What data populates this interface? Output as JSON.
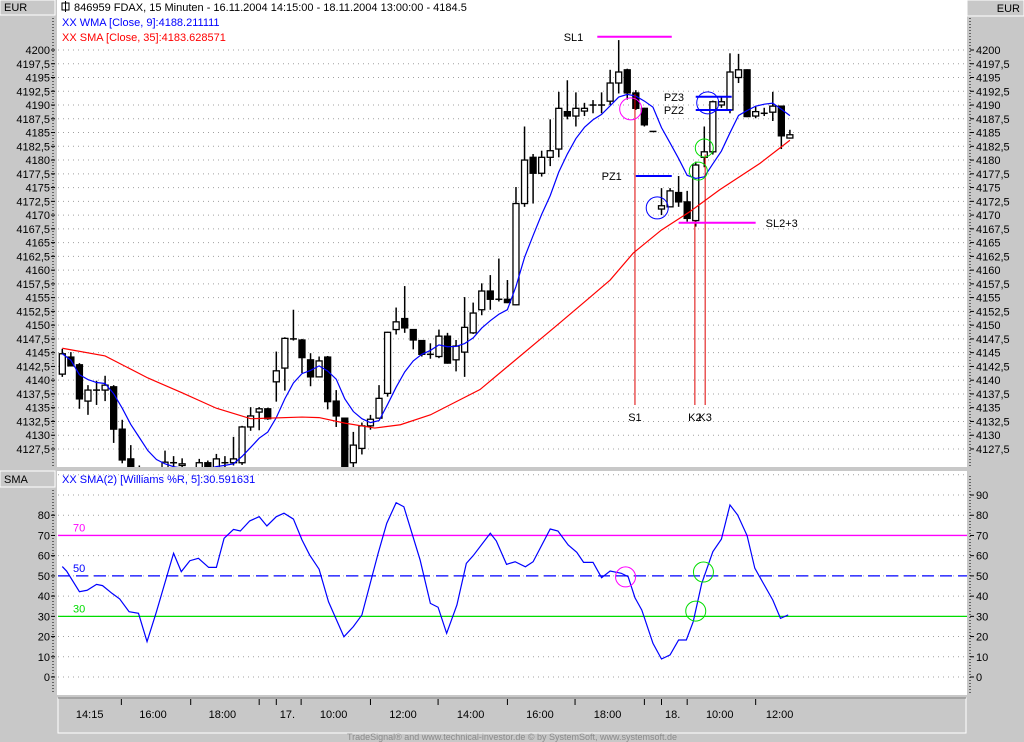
{
  "header": {
    "left_unit": "EUR",
    "right_unit": "EUR",
    "title": "846959  FDAX, 15 Minuten - 16.11.2004 14:15:00 - 18.11.2004 13:00:00 - 4184.5",
    "legend_wma": "XX WMA [Close, 9]:4188.211111",
    "legend_sma": "XX SMA [Close, 35]:4183.628571",
    "indicator_unit": "SMA",
    "legend_indicator": "XX SMA(2) [Williams %R, 5]:30.591631"
  },
  "footer": "TradeSignal® and www.technical-investor.de © by SystemSoft, www.systemsoft.de",
  "colors": {
    "wma": "#0000ff",
    "sma": "#ff0000",
    "level70": "#ff00ff",
    "level50": "#0000ff",
    "level30": "#00e000",
    "annot_magenta": "#ff00ff",
    "annot_blue": "#0000ff",
    "annot_green": "#00dd00",
    "vline": "#dd0000"
  },
  "chart_data": [
    {
      "type": "candlestick",
      "title": "846959 FDAX, 15 Minuten",
      "ylim": [
        4127.5,
        4200
      ],
      "price_ticks": [
        "4200",
        "4197,5",
        "4195",
        "4192,5",
        "4190",
        "4187,5",
        "4185",
        "4182,5",
        "4180",
        "4177,5",
        "4175",
        "4172,5",
        "4170",
        "4167,5",
        "4165",
        "4162,5",
        "4160",
        "4157,5",
        "4155",
        "4152,5",
        "4150",
        "4147,5",
        "4145",
        "4142,5",
        "4140",
        "4137,5",
        "4135",
        "4132,5",
        "4130",
        "4127,5"
      ],
      "price_tick_values": [
        4200,
        4197.5,
        4195,
        4192.5,
        4190,
        4187.5,
        4185,
        4182.5,
        4180,
        4177.5,
        4175,
        4172.5,
        4170,
        4167.5,
        4165,
        4162.5,
        4160,
        4157.5,
        4155,
        4152.5,
        4150,
        4147.5,
        4145,
        4142.5,
        4140,
        4137.5,
        4135,
        4132.5,
        4130,
        4127.5
      ],
      "ohlc_columns": [
        "open",
        "high",
        "low",
        "close"
      ],
      "ohlc": [
        [
          4141.1,
          4145.7,
          4140.6,
          4144.8
        ],
        [
          4144.2,
          4145.1,
          4142.6,
          4142.6
        ],
        [
          4142.8,
          4143.1,
          4134.8,
          4136.6
        ],
        [
          4136.2,
          4139.1,
          4133.7,
          4138.2
        ],
        [
          4138.2,
          4139.9,
          4135.5,
          4138.2
        ],
        [
          4138.2,
          4140.8,
          4136.2,
          4139.1
        ],
        [
          4138.8,
          4139.1,
          4128.6,
          4131.1
        ],
        [
          4131.1,
          4132.8,
          4124.9,
          4125.5
        ],
        [
          4125.7,
          4128.2,
          4120,
          4122
        ],
        [
          4123,
          4124.5,
          4121,
          4123.5
        ],
        [
          4122.5,
          4123.5,
          4120,
          4121
        ],
        [
          4121,
          4123,
          4119.5,
          4122.5
        ],
        [
          4124,
          4127.2,
          4122,
          4125.1
        ],
        [
          4125,
          4126.2,
          4123,
          4125
        ],
        [
          4124.5,
          4125.8,
          4123,
          4124.8
        ],
        [
          4122,
          4123.5,
          4121,
          4123
        ],
        [
          4123,
          4125.7,
          4122,
          4125
        ],
        [
          4125,
          4125.4,
          4122,
          4123
        ],
        [
          4123,
          4126.6,
          4122,
          4125.7
        ],
        [
          4125,
          4126.2,
          4124,
          4125
        ],
        [
          4125,
          4129.7,
          4124.5,
          4125.7
        ],
        [
          4125,
          4131.7,
          4124.6,
          4131.5
        ],
        [
          4131.5,
          4135.1,
          4130.8,
          4133.5
        ],
        [
          4134.2,
          4135.1,
          4130.9,
          4134.8
        ],
        [
          4134.8,
          4135,
          4132.8,
          4133
        ],
        [
          4139.7,
          4145.2,
          4136.1,
          4141.7
        ],
        [
          4142.2,
          4147.8,
          4138.1,
          4147.6
        ],
        [
          4147.5,
          4152.8,
          4147.2,
          4147.5
        ],
        [
          4147.3,
          4147.5,
          4141.3,
          4144.1
        ],
        [
          4143.7,
          4144.9,
          4138.9,
          4140.6
        ],
        [
          4140.6,
          4144.3,
          4140.5,
          4143.5
        ],
        [
          4144.2,
          4144.4,
          4134.7,
          4136.1
        ],
        [
          4136.2,
          4138.2,
          4131.5,
          4133.5
        ],
        [
          4133.1,
          4133.1,
          4122,
          4123
        ],
        [
          4125,
          4130.6,
          4123,
          4128.2
        ],
        [
          4127.6,
          4132.3,
          4126.5,
          4131.7
        ],
        [
          4131.7,
          4133.7,
          4131,
          4132.9
        ],
        [
          4133.1,
          4139.1,
          4133,
          4136.7
        ],
        [
          4137.6,
          4148.8,
          4137,
          4148.7
        ],
        [
          4149.2,
          4153.2,
          4148.3,
          4150.6
        ],
        [
          4151.2,
          4157.1,
          4148.6,
          4149.5
        ],
        [
          4149.2,
          4149.3,
          4145.6,
          4147.3
        ],
        [
          4147.2,
          4147.3,
          4144.3,
          4144.7
        ],
        [
          4144.7,
          4146.7,
          4143.9,
          4144.7
        ],
        [
          4144.3,
          4149.2,
          4144,
          4148
        ],
        [
          4148,
          4148.6,
          4143,
          4143.1
        ],
        [
          4143.7,
          4147.3,
          4141.6,
          4146.2
        ],
        [
          4145.1,
          4155.1,
          4140.6,
          4149.6
        ],
        [
          4148.6,
          4154.1,
          4148.4,
          4152.2
        ],
        [
          4152.8,
          4157.6,
          4151.8,
          4156.2
        ],
        [
          4156.2,
          4159.1,
          4152.8,
          4154.7
        ],
        [
          4154.7,
          4162.1,
          4154.3,
          4154.7
        ],
        [
          4154.7,
          4158.2,
          4154,
          4154.1
        ],
        [
          4153.7,
          4175.1,
          4153.6,
          4172.1
        ],
        [
          4172.1,
          4186.1,
          4171.5,
          4180
        ],
        [
          4180.5,
          4181.1,
          4172.1,
          4177.6
        ],
        [
          4177.6,
          4181.7,
          4177,
          4180.5
        ],
        [
          4180.5,
          4187.4,
          4178.9,
          4181.7
        ],
        [
          4182,
          4192.4,
          4180.5,
          4189.4
        ],
        [
          4188.8,
          4194.5,
          4187.4,
          4188
        ],
        [
          4188,
          4192.3,
          4186.1,
          4189.4
        ],
        [
          4188.9,
          4190.4,
          4188,
          4189.4
        ],
        [
          4190,
          4190.9,
          4188.5,
          4190
        ],
        [
          4190,
          4192.3,
          4188.5,
          4190
        ],
        [
          4190.7,
          4196.4,
          4190,
          4194
        ],
        [
          4194,
          4201.8,
          4192.1,
          4196
        ],
        [
          4196.4,
          4196.6,
          4191,
          4192.2
        ],
        [
          4192.2,
          4192.7,
          4189.1,
          4189.4
        ],
        [
          4189.4,
          4189.5,
          4186.1,
          4186.4
        ],
        [
          4185.2,
          4185.2,
          4185.2,
          4185.2
        ],
        [
          4171.1,
          4174.9,
          4170,
          4171.7
        ],
        [
          4171.5,
          4174.9,
          4171.5,
          4174.4
        ],
        [
          4174.1,
          4177.1,
          4171.5,
          4172.4
        ],
        [
          4172.4,
          4174.4,
          4168.8,
          4169.4
        ],
        [
          4169,
          4179.7,
          4167.9,
          4179.1
        ],
        [
          4180.5,
          4186.1,
          4178.7,
          4181.5
        ],
        [
          4181.5,
          4190.8,
          4181,
          4190.6
        ],
        [
          4190,
          4191.5,
          4189.5,
          4190.6
        ],
        [
          4189.1,
          4199.4,
          4188.5,
          4196
        ],
        [
          4195,
          4199.3,
          4194,
          4196.4
        ],
        [
          4196.4,
          4196.5,
          4187.8,
          4187.9
        ],
        [
          4188,
          4189.7,
          4187.6,
          4188.8
        ],
        [
          4188.5,
          4189.5,
          4188,
          4188.5
        ],
        [
          4188.7,
          4192.4,
          4187.1,
          4189.8
        ],
        [
          4189.8,
          4189.9,
          4182,
          4184.4
        ],
        [
          4184,
          4185.5,
          4183.9,
          4184.6
        ]
      ],
      "wma_period": 9,
      "sma_points": [
        [
          0,
          4145.8
        ],
        [
          5,
          4144.4
        ],
        [
          10,
          4140.4
        ],
        [
          14,
          4137.7
        ],
        [
          18,
          4134.9
        ],
        [
          22,
          4133.0
        ],
        [
          28,
          4133.3
        ],
        [
          30,
          4133.2
        ],
        [
          33,
          4132.2
        ],
        [
          36.5,
          4131.3
        ],
        [
          39.5,
          4131.9
        ],
        [
          43,
          4133.7
        ],
        [
          48.8,
          4138.3
        ],
        [
          57.8,
          4150
        ],
        [
          61.3,
          4154.6
        ],
        [
          64,
          4158.2
        ],
        [
          66.7,
          4163.1
        ],
        [
          70,
          4167.3
        ],
        [
          73.3,
          4170.6
        ],
        [
          76.8,
          4174.6
        ],
        [
          81.5,
          4179.4
        ],
        [
          85,
          4183.6
        ]
      ],
      "annotations": {
        "hlines": [
          {
            "label": "SL1",
            "price": 4202.4,
            "from": 62.5,
            "to": 71.2,
            "color": "magenta",
            "label_side": "left"
          },
          {
            "label": "PZ1",
            "price": 4177.1,
            "from": 67.0,
            "to": 71.2,
            "color": "blue",
            "label_side": "left"
          },
          {
            "label": "PZ3",
            "price": 4191.5,
            "from": 74.0,
            "to": 78.2,
            "color": "blue",
            "label_side": "left"
          },
          {
            "label": "PZ2",
            "price": 4189.1,
            "from": 74.0,
            "to": 78.2,
            "color": "blue",
            "label_side": "left"
          },
          {
            "label": "SL2+3",
            "price": 4168.6,
            "from": 72.0,
            "to": 81.0,
            "color": "magenta",
            "label_side": "right"
          }
        ],
        "vlines": [
          {
            "label": "S1",
            "index": 66.9,
            "top_price": 4192.0
          },
          {
            "label": "K2",
            "index": 73.9,
            "top_price": 4169.0
          },
          {
            "label": "K3",
            "index": 75.1,
            "top_price": 4181.0
          }
        ],
        "circles": [
          {
            "index": 66.4,
            "price": 4189.3,
            "color": "magenta"
          },
          {
            "index": 69.5,
            "price": 4171.3,
            "color": "blue"
          },
          {
            "index": 74.3,
            "price": 4178.0,
            "color": "green"
          },
          {
            "index": 75.0,
            "price": 4182.2,
            "color": "green"
          },
          {
            "index": 75.4,
            "price": 4190.4,
            "color": "blue"
          }
        ]
      }
    },
    {
      "type": "line",
      "title": "SMA(2) [Williams %R, 5]",
      "ylim": [
        0,
        100
      ],
      "ticks_left": [
        "80",
        "70",
        "60",
        "50",
        "40",
        "30",
        "20",
        "10",
        "0"
      ],
      "ticks_right": [
        "90",
        "80",
        "70",
        "60",
        "50",
        "40",
        "30",
        "20",
        "10",
        "0"
      ],
      "levels": [
        {
          "label": "70",
          "value": 70,
          "color": "magenta"
        },
        {
          "label": "50",
          "value": 50,
          "color": "blue",
          "dashed": true
        },
        {
          "label": "30",
          "value": 30,
          "color": "green"
        }
      ],
      "points": [
        [
          0,
          54.6
        ],
        [
          0.5,
          52.4
        ],
        [
          2.0,
          42.2
        ],
        [
          2.9,
          42.9
        ],
        [
          4.0,
          45.8
        ],
        [
          4.7,
          45.2
        ],
        [
          5.8,
          41.4
        ],
        [
          6.7,
          38.6
        ],
        [
          7.8,
          32.3
        ],
        [
          8.9,
          31.5
        ],
        [
          9.9,
          17.5
        ],
        [
          11.0,
          32.3
        ],
        [
          13.0,
          61.2
        ],
        [
          13.9,
          52.1
        ],
        [
          14.9,
          57.5
        ],
        [
          15.9,
          58.7
        ],
        [
          17.1,
          54.2
        ],
        [
          18.0,
          54.2
        ],
        [
          18.9,
          68.6
        ],
        [
          20.0,
          73
        ],
        [
          20.8,
          72.2
        ],
        [
          21.9,
          77.2
        ],
        [
          23.0,
          79.3
        ],
        [
          23.9,
          74.7
        ],
        [
          25.0,
          79.3
        ],
        [
          25.9,
          81
        ],
        [
          27.0,
          78.1
        ],
        [
          28.0,
          67.8
        ],
        [
          28.9,
          60.3
        ],
        [
          30.0,
          53.3
        ],
        [
          31.1,
          37.2
        ],
        [
          32.9,
          19.9
        ],
        [
          34.0,
          24.9
        ],
        [
          35.0,
          30.7
        ],
        [
          36.9,
          61.2
        ],
        [
          37.9,
          76
        ],
        [
          39.0,
          86.2
        ],
        [
          39.9,
          84.2
        ],
        [
          41.8,
          57.9
        ],
        [
          43.0,
          36.4
        ],
        [
          43.9,
          34.5
        ],
        [
          44.9,
          21.6
        ],
        [
          46.1,
          35.6
        ],
        [
          47.2,
          56.2
        ],
        [
          48.0,
          60
        ],
        [
          50.0,
          71.1
        ],
        [
          50.7,
          67.3
        ],
        [
          51.9,
          55.7
        ],
        [
          52.9,
          57
        ],
        [
          54.1,
          54.5
        ],
        [
          55.0,
          57
        ],
        [
          57.0,
          73.2
        ],
        [
          57.9,
          72.2
        ],
        [
          59.1,
          65.3
        ],
        [
          60.1,
          61.7
        ],
        [
          60.9,
          56.7
        ],
        [
          62.0,
          56.7
        ],
        [
          63.0,
          49.1
        ],
        [
          64.0,
          52.4
        ],
        [
          65.3,
          51.3
        ],
        [
          66.1,
          49.6
        ],
        [
          66.9,
          39.2
        ],
        [
          67.7,
          33.1
        ],
        [
          69.0,
          16.7
        ],
        [
          70.0,
          8.9
        ],
        [
          71.0,
          10.9
        ],
        [
          72.0,
          18.3
        ],
        [
          72.9,
          18.3
        ],
        [
          73.7,
          27.3
        ],
        [
          74.7,
          46.3
        ],
        [
          76.0,
          62
        ],
        [
          77.0,
          68.2
        ],
        [
          78.0,
          85.1
        ],
        [
          78.9,
          80.1
        ],
        [
          80.0,
          69.9
        ],
        [
          80.9,
          53.8
        ],
        [
          81.9,
          46.3
        ],
        [
          83.0,
          38.1
        ],
        [
          83.9,
          29
        ],
        [
          84.8,
          30.7
        ]
      ],
      "circles": [
        {
          "index": 65.8,
          "value": 49.5,
          "color": "magenta"
        },
        {
          "index": 74.9,
          "value": 51.9,
          "color": "green"
        },
        {
          "index": 74.0,
          "value": 32.6,
          "color": "green"
        }
      ]
    }
  ],
  "time_axis": {
    "labels": [
      {
        "text": "14:15",
        "index": 3.2
      },
      {
        "text": "16:00",
        "index": 10.6
      },
      {
        "text": "18:00",
        "index": 18.7
      },
      {
        "text": "17.",
        "index": 26.3
      },
      {
        "text": "10:00",
        "index": 31.7
      },
      {
        "text": "12:00",
        "index": 39.8
      },
      {
        "text": "14:00",
        "index": 47.7
      },
      {
        "text": "16:00",
        "index": 55.8
      },
      {
        "text": "18:00",
        "index": 63.7
      },
      {
        "text": "18.",
        "index": 71.3
      },
      {
        "text": "10:00",
        "index": 76.8
      },
      {
        "text": "12:00",
        "index": 83.8
      }
    ],
    "ticks": [
      6.9,
      15,
      23,
      25,
      27.9,
      36,
      43.9,
      52,
      59.9,
      68,
      70,
      73,
      81
    ]
  }
}
